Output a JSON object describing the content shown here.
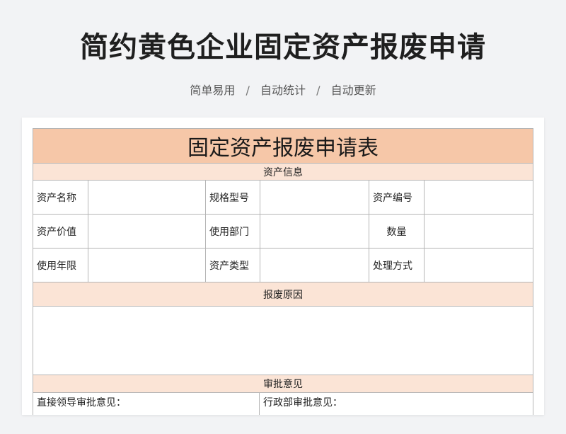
{
  "header": {
    "title": "简约黄色企业固定资产报废申请",
    "tags": [
      "简单易用",
      "自动统计",
      "自动更新"
    ],
    "separator": "/"
  },
  "form": {
    "title": "固定资产报废申请表",
    "section_asset": "资产信息",
    "rows": [
      [
        "资产名称",
        "规格型号",
        "资产编号"
      ],
      [
        "资产价值",
        "使用部门",
        "数量"
      ],
      [
        "使用年限",
        "资产类型",
        "处理方式"
      ]
    ],
    "section_reason": "报废原因",
    "section_approval": "审批意见",
    "approval_labels": [
      "直接领导审批意见：",
      "行政部审批意见："
    ]
  },
  "colors": {
    "title_band": "#f6c7a8",
    "section_band": "#fbe4d6",
    "border": "#b5b5b5"
  }
}
